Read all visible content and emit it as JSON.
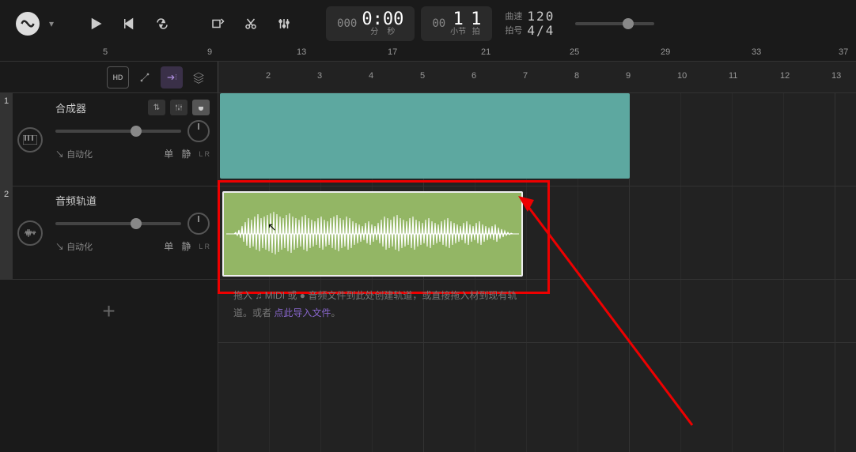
{
  "toolbar": {
    "time_prefix": "000",
    "time_main": "0:00",
    "time_min_lbl": "分",
    "time_sec_lbl": "秒",
    "bar_prefix": "00",
    "bar": "1",
    "beat": "1",
    "bar_lbl": "小节",
    "beat_lbl": "拍"
  },
  "tempo": {
    "tempo_lbl": "曲速",
    "tempo_val": "120",
    "sig_lbl": "拍号",
    "sig_val": "4/4"
  },
  "ruler_top": [
    "5",
    "9",
    "13",
    "17",
    "21",
    "25",
    "29",
    "33",
    "37"
  ],
  "ruler2": [
    "2",
    "3",
    "4",
    "5",
    "6",
    "7",
    "8",
    "9",
    "10",
    "11",
    "12",
    "13"
  ],
  "track1": {
    "num": "1",
    "name": "合成器",
    "auto": "自动化",
    "solo": "单",
    "mute": "静",
    "lr": "L   R"
  },
  "track2": {
    "num": "2",
    "name": "音频轨道",
    "auto": "自动化",
    "solo": "单",
    "mute": "静",
    "lr": "L   R"
  },
  "drop": {
    "text1": "拖入",
    "text2": "MIDI 或",
    "text3": "音频文件到此处创建轨道，或直接拖入",
    "text3b": "材到现有轨",
    "text4": "道。或者",
    "link": "点此导入文件",
    "dot": "。"
  },
  "hd_label": "HD"
}
